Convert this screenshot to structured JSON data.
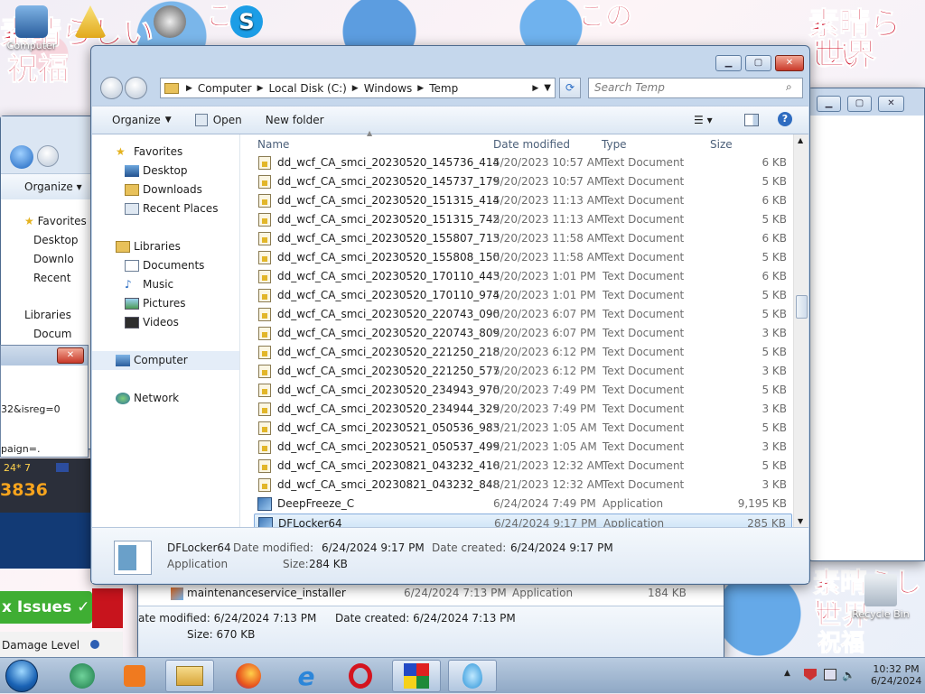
{
  "desktop": {
    "icons": [
      {
        "label": "Computer"
      },
      {
        "label": "Pl"
      },
      {
        "label": "Recycle Bin"
      }
    ],
    "kanji": [
      "この",
      "素晴らしい",
      "世界",
      "に",
      "祝福",
      "を！"
    ]
  },
  "explorer": {
    "breadcrumbs": [
      "Computer",
      "Local Disk (C:)",
      "Windows",
      "Temp"
    ],
    "search_placeholder": "Search Temp",
    "toolbar": {
      "organize": "Organize",
      "open": "Open",
      "new_folder": "New folder"
    },
    "nav": {
      "favorites": "Favorites",
      "favorite_items": [
        "Desktop",
        "Downloads",
        "Recent Places"
      ],
      "libraries": "Libraries",
      "library_items": [
        "Documents",
        "Music",
        "Pictures",
        "Videos"
      ],
      "computer": "Computer",
      "network": "Network"
    },
    "columns": {
      "name": "Name",
      "date": "Date modified",
      "type": "Type",
      "size": "Size"
    },
    "files": [
      {
        "name": "dd_wcf_CA_smci_20230520_145736_414",
        "date": "5/20/2023 10:57 AM",
        "type": "Text Document",
        "size": "6 KB"
      },
      {
        "name": "dd_wcf_CA_smci_20230520_145737_179",
        "date": "5/20/2023 10:57 AM",
        "type": "Text Document",
        "size": "5 KB"
      },
      {
        "name": "dd_wcf_CA_smci_20230520_151315_414",
        "date": "5/20/2023 11:13 AM",
        "type": "Text Document",
        "size": "6 KB"
      },
      {
        "name": "dd_wcf_CA_smci_20230520_151315_742",
        "date": "5/20/2023 11:13 AM",
        "type": "Text Document",
        "size": "5 KB"
      },
      {
        "name": "dd_wcf_CA_smci_20230520_155807_713",
        "date": "5/20/2023 11:58 AM",
        "type": "Text Document",
        "size": "6 KB"
      },
      {
        "name": "dd_wcf_CA_smci_20230520_155808_150",
        "date": "5/20/2023 11:58 AM",
        "type": "Text Document",
        "size": "5 KB"
      },
      {
        "name": "dd_wcf_CA_smci_20230520_170110_443",
        "date": "5/20/2023 1:01 PM",
        "type": "Text Document",
        "size": "6 KB"
      },
      {
        "name": "dd_wcf_CA_smci_20230520_170110_974",
        "date": "5/20/2023 1:01 PM",
        "type": "Text Document",
        "size": "5 KB"
      },
      {
        "name": "dd_wcf_CA_smci_20230520_220743_090",
        "date": "5/20/2023 6:07 PM",
        "type": "Text Document",
        "size": "5 KB"
      },
      {
        "name": "dd_wcf_CA_smci_20230520_220743_809",
        "date": "5/20/2023 6:07 PM",
        "type": "Text Document",
        "size": "3 KB"
      },
      {
        "name": "dd_wcf_CA_smci_20230520_221250_218",
        "date": "5/20/2023 6:12 PM",
        "type": "Text Document",
        "size": "5 KB"
      },
      {
        "name": "dd_wcf_CA_smci_20230520_221250_577",
        "date": "5/20/2023 6:12 PM",
        "type": "Text Document",
        "size": "3 KB"
      },
      {
        "name": "dd_wcf_CA_smci_20230520_234943_970",
        "date": "5/20/2023 7:49 PM",
        "type": "Text Document",
        "size": "5 KB"
      },
      {
        "name": "dd_wcf_CA_smci_20230520_234944_329",
        "date": "5/20/2023 7:49 PM",
        "type": "Text Document",
        "size": "3 KB"
      },
      {
        "name": "dd_wcf_CA_smci_20230521_050536_983",
        "date": "5/21/2023 1:05 AM",
        "type": "Text Document",
        "size": "5 KB"
      },
      {
        "name": "dd_wcf_CA_smci_20230521_050537_499",
        "date": "5/21/2023 1:05 AM",
        "type": "Text Document",
        "size": "3 KB"
      },
      {
        "name": "dd_wcf_CA_smci_20230821_043232_410",
        "date": "8/21/2023 12:32 AM",
        "type": "Text Document",
        "size": "5 KB"
      },
      {
        "name": "dd_wcf_CA_smci_20230821_043232_848",
        "date": "8/21/2023 12:32 AM",
        "type": "Text Document",
        "size": "3 KB"
      },
      {
        "name": "DeepFreeze_C",
        "date": "6/24/2024 7:49 PM",
        "type": "Application",
        "size": "9,195 KB"
      },
      {
        "name": "DFLocker64",
        "date": "6/24/2024 9:17 PM",
        "type": "Application",
        "size": "285 KB"
      }
    ],
    "details": {
      "name": "DFLocker64",
      "type": "Application",
      "date_modified_label": "Date modified:",
      "date_modified": "6/24/2024 9:17 PM",
      "date_created_label": "Date created:",
      "date_created": "6/24/2024 9:17 PM",
      "size_label": "Size:",
      "size": "284 KB"
    }
  },
  "left_window": {
    "organize": "Organize",
    "nav": [
      "Favorites",
      "Desktop",
      "Downlo",
      "Recent",
      "Libraries",
      "Docum"
    ]
  },
  "left_popup": {
    "lines": [
      "32&isreg=0",
      "paign=."
    ],
    "chip": "24* 7",
    "number": "3836",
    "issues_button": "x Issues ✓",
    "damage_label": "Damage Level"
  },
  "bottom_window": {
    "file": {
      "name": "maintenanceservice_installer",
      "date": "6/24/2024 7:13 PM",
      "type": "Application",
      "size": "184 KB"
    },
    "details": {
      "date_modified": "ate modified:  6/24/2024 7:13 PM",
      "date_created": "Date created:  6/24/2024 7:13 PM",
      "size": "Size:  670 KB"
    }
  },
  "tray": {
    "time": "10:32 PM",
    "date": "6/24/2024"
  },
  "colors": {
    "accent": "#3a6ea5",
    "selection": "#cbe3f7",
    "close": "#c8392a",
    "brand_red": "#d0102a"
  }
}
